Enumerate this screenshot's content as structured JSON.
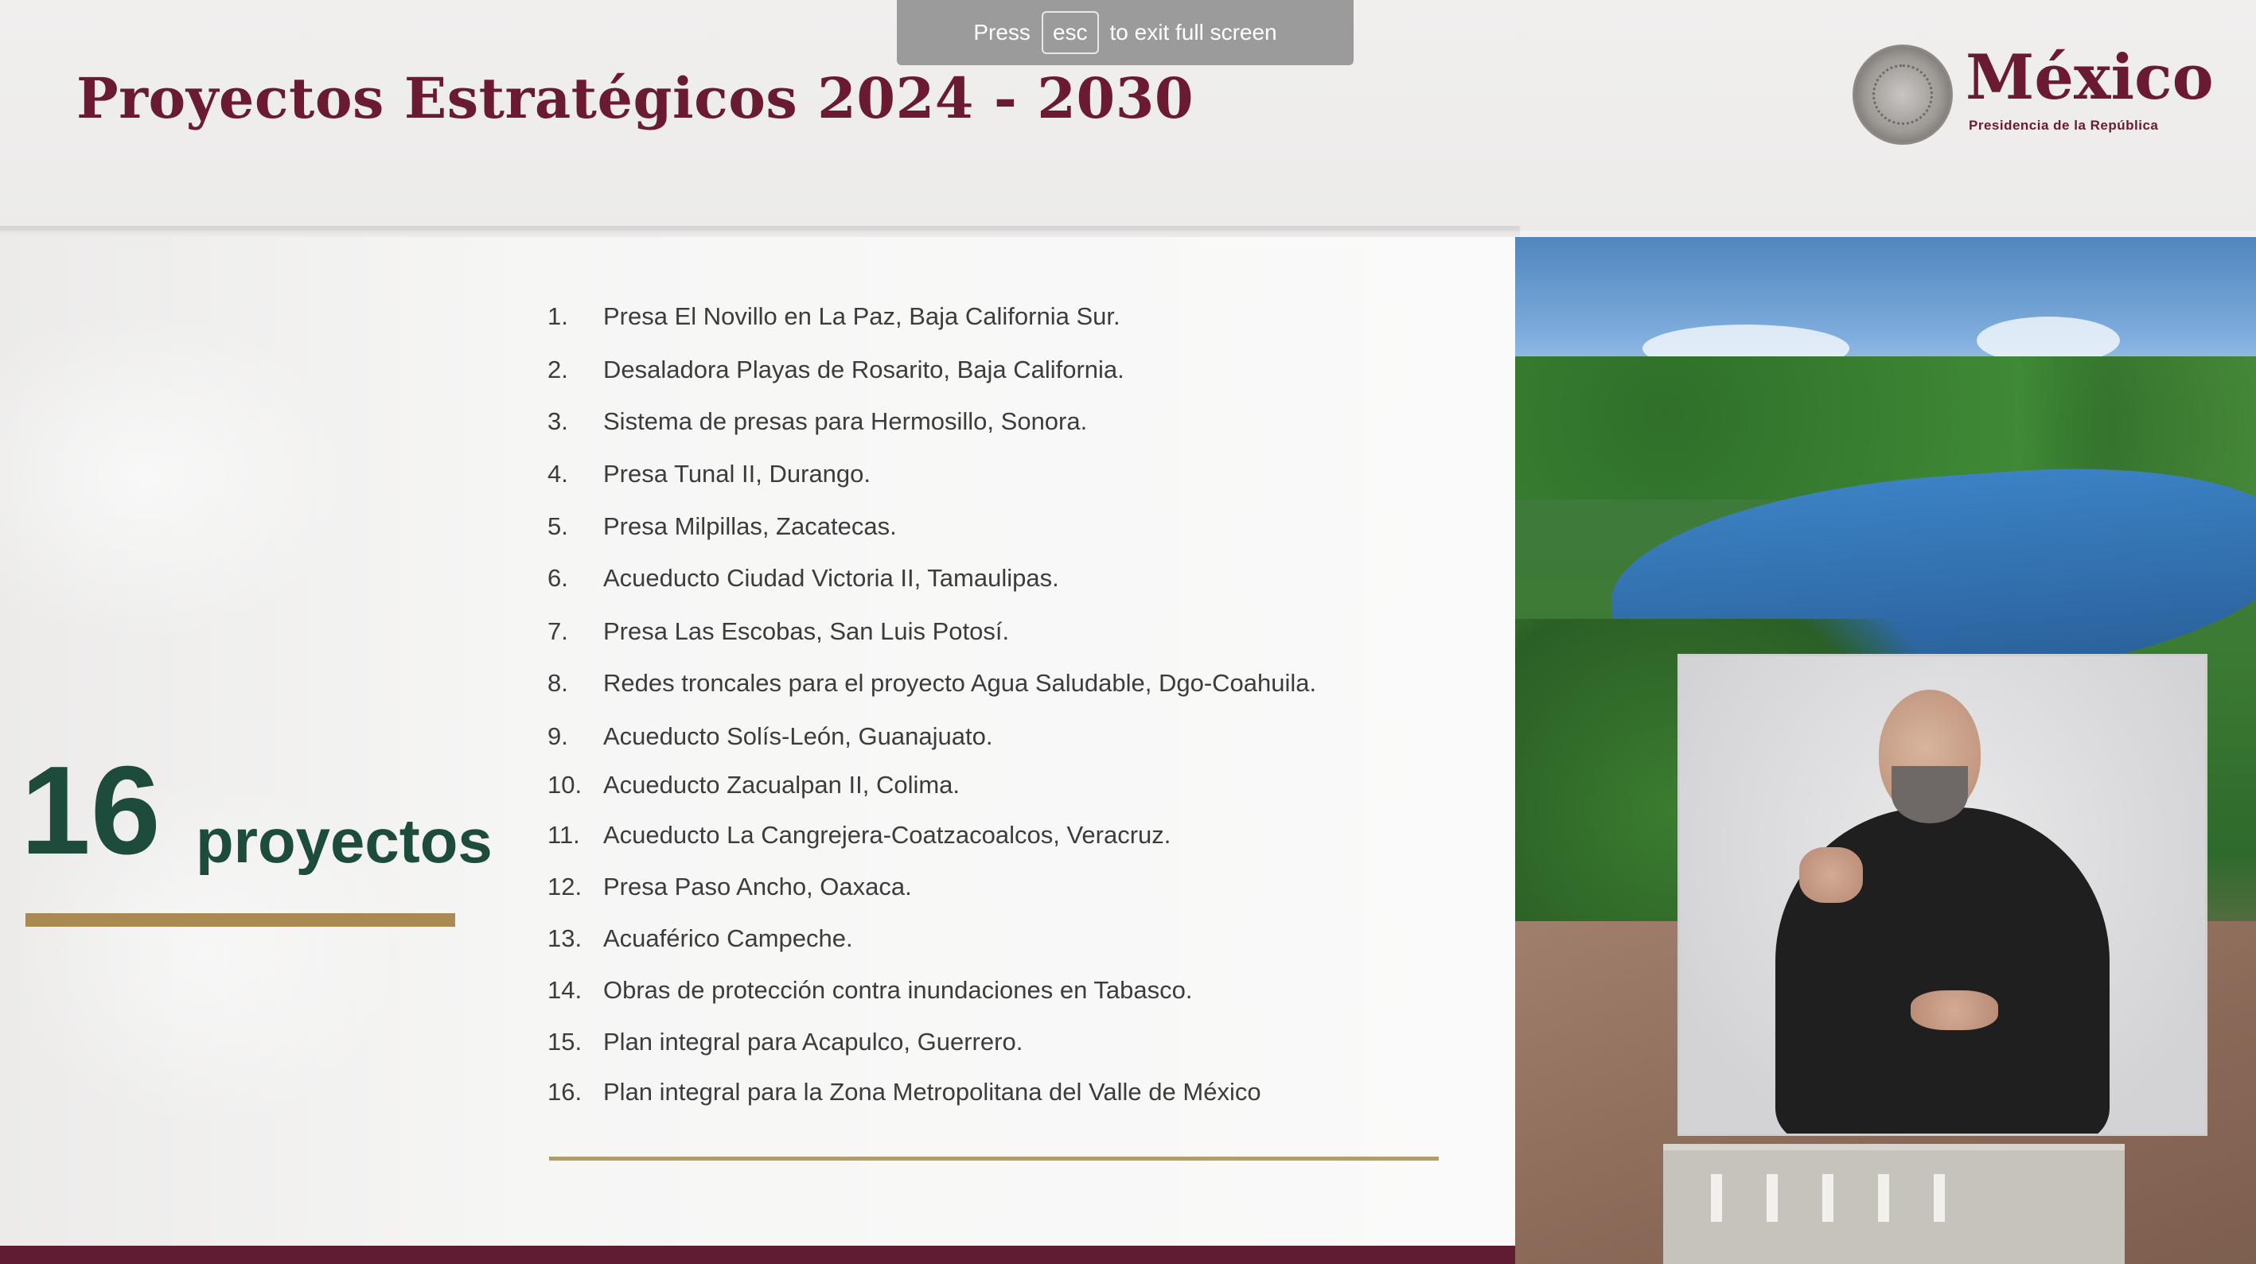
{
  "browser": {
    "fullscreen_notice": {
      "prefix": "Press",
      "key": "esc",
      "suffix": "to exit full screen"
    }
  },
  "slide": {
    "title": "Proyectos Estratégicos 2024 - 2030",
    "logo": {
      "word": "México",
      "subtitle": "Presidencia de la República"
    },
    "count": {
      "number": "16",
      "label": "proyectos"
    },
    "projects": [
      {
        "num": "1.",
        "text": "Presa El Novillo en La Paz, Baja California Sur."
      },
      {
        "num": "2.",
        "text": "Desaladora Playas de Rosarito, Baja California."
      },
      {
        "num": "3.",
        "text": "Sistema de presas para Hermosillo, Sonora."
      },
      {
        "num": "4.",
        "text": "Presa Tunal II, Durango."
      },
      {
        "num": "5.",
        "text": "Presa Milpillas, Zacatecas."
      },
      {
        "num": "6.",
        "text": "Acueducto Ciudad Victoria II, Tamaulipas."
      },
      {
        "num": "7.",
        "text": "Presa Las Escobas, San Luis Potosí."
      },
      {
        "num": "8.",
        "text": "Redes troncales para el proyecto Agua Saludable, Dgo-Coahuila."
      },
      {
        "num": "9.",
        "text": "Acueducto Solís-León, Guanajuato."
      },
      {
        "num": "10.",
        "text": "Acueducto Zacualpan II, Colima."
      },
      {
        "num": "11.",
        "text": "Acueducto La Cangrejera-Coatzacoalcos, Veracruz."
      },
      {
        "num": "12.",
        "text": "Presa Paso Ancho, Oaxaca."
      },
      {
        "num": "13.",
        "text": "Acuaférico Campeche."
      },
      {
        "num": "14.",
        "text": "Obras de protección contra inundaciones en Tabasco."
      },
      {
        "num": "15.",
        "text": "Plan integral para Acapulco, Guerrero."
      },
      {
        "num": "16.",
        "text": "Plan integral para la Zona Metropolitana del Valle de México"
      }
    ]
  },
  "colors": {
    "title": "#6a1b32",
    "count": "#1d4b3c",
    "gold_bar": "#a98a52",
    "bottom_strip": "#5f1d33"
  }
}
